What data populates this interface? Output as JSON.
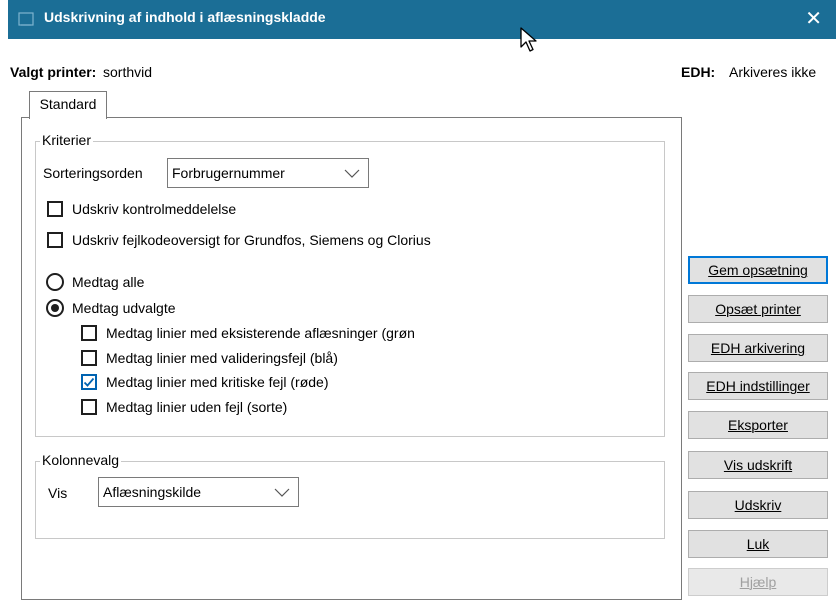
{
  "window": {
    "title": "Udskrivning af indhold i aflæsningskladde",
    "close_glyph": "✕",
    "titlebar_color": "#1b6e96"
  },
  "info": {
    "printer_label": "Valgt printer:",
    "printer_value": "sorthvid",
    "edh_label": "EDH:",
    "edh_value": "Arkiveres ikke"
  },
  "tab": {
    "label": "Standard"
  },
  "criteria": {
    "legend": "Kriterier",
    "sort_label": "Sorteringsorden",
    "sort_value": "Forbrugernummer",
    "control_msg": {
      "label": "Udskriv kontrolmeddelelse",
      "checked": false
    },
    "error_overview": {
      "label": "Udskriv fejlkodeoversigt for Grundfos, Siemens og Clorius",
      "checked": false
    },
    "include_all": {
      "label": "Medtag alle",
      "selected": false
    },
    "include_selected": {
      "label": "Medtag udvalgte",
      "selected": true
    },
    "sub_options": [
      {
        "label": "Medtag linier med eksisterende aflæsninger (grøn",
        "checked": false
      },
      {
        "label": "Medtag linier med valideringsfejl (blå)",
        "checked": false
      },
      {
        "label": "Medtag linier med kritiske fejl (røde)",
        "checked": true
      },
      {
        "label": "Medtag linier uden fejl (sorte)",
        "checked": false
      }
    ]
  },
  "columns": {
    "legend": "Kolonnevalg",
    "vis_label": "Vis",
    "vis_value": "Aflæsningskilde"
  },
  "buttons": {
    "save": "Gem opsætning",
    "setup_printer": "Opsæt printer",
    "edh_archive": "EDH arkivering",
    "edh_settings": "EDH indstillinger",
    "export": "Eksporter",
    "preview": "Vis udskrift",
    "print": "Udskriv",
    "close": "Luk",
    "help": "Hjælp"
  },
  "colors": {
    "accent": "#0078d7",
    "check": "#0063b1"
  }
}
